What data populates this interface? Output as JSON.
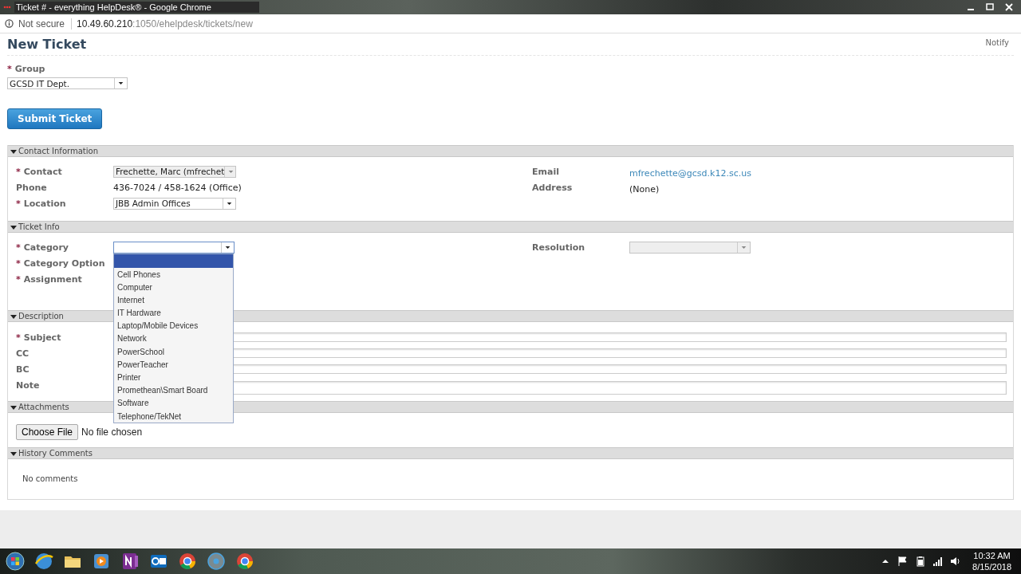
{
  "browser": {
    "tab_title": "Ticket # - everything HelpDesk® - Google Chrome",
    "security": "Not secure",
    "url_host": "10.49.60.210",
    "url_rest": ":1050/ehelpdesk/tickets/new"
  },
  "required_mark": "*",
  "page": {
    "title": "New Ticket",
    "notify": "Notify",
    "group": {
      "label": "Group",
      "required": true,
      "value": "GCSD IT Dept."
    },
    "submit": "Submit Ticket"
  },
  "contact": {
    "title": "Contact Information",
    "expanded": true,
    "left": [
      {
        "label": "Contact",
        "required": true,
        "kind": "select",
        "value": "Frechette, Marc (mfrechet",
        "disabled": true
      },
      {
        "label": "Phone",
        "required": false,
        "kind": "text",
        "value": "436-7024 / 458-1624 (Office)"
      },
      {
        "label": "Location",
        "required": true,
        "kind": "select",
        "value": "JBB Admin Offices",
        "disabled": false
      }
    ],
    "right": [
      {
        "label": "Email",
        "kind": "link",
        "value": "mfrechette@gcsd.k12.sc.us"
      },
      {
        "label": "Address",
        "kind": "text",
        "value": "(None)"
      }
    ]
  },
  "ticket_info": {
    "title": "Ticket Info",
    "expanded": true,
    "category": {
      "label": "Category",
      "required": true,
      "open": true,
      "blank_highlighted": true,
      "options": [
        {
          "label": "Cell Phones",
          "selected": false
        },
        {
          "label": "Computer",
          "selected": false
        },
        {
          "label": "Internet",
          "selected": false
        },
        {
          "label": "IT Hardware",
          "selected": false
        },
        {
          "label": "Laptop/Mobile Devices",
          "selected": false
        },
        {
          "label": "Network",
          "selected": false
        },
        {
          "label": "PowerSchool",
          "selected": false
        },
        {
          "label": "PowerTeacher",
          "selected": false
        },
        {
          "label": "Printer",
          "selected": false
        },
        {
          "label": "Promethean\\Smart Board",
          "selected": false
        },
        {
          "label": "Software",
          "selected": false
        },
        {
          "label": "Telephone/TekNet",
          "selected": false
        }
      ]
    },
    "other": [
      {
        "label": "Category Option",
        "required": true
      },
      {
        "label": "Assignment",
        "required": true
      }
    ],
    "resolution": {
      "label": "Resolution",
      "disabled": true
    }
  },
  "description": {
    "title": "Description",
    "expanded": true,
    "fields": [
      {
        "label": "Subject",
        "required": true,
        "kind": "input"
      },
      {
        "label": "CC",
        "required": false,
        "kind": "input"
      },
      {
        "label": "BC",
        "required": false,
        "kind": "input"
      },
      {
        "label": "Note",
        "required": false,
        "kind": "textarea"
      }
    ]
  },
  "attachments": {
    "title": "Attachments",
    "expanded": true,
    "button": "Choose File",
    "status": "No file chosen"
  },
  "history": {
    "title": "History Comments",
    "expanded": true,
    "empty_text": "No comments"
  },
  "taskbar": {
    "time": "10:32 AM",
    "date": "8/15/2018"
  }
}
